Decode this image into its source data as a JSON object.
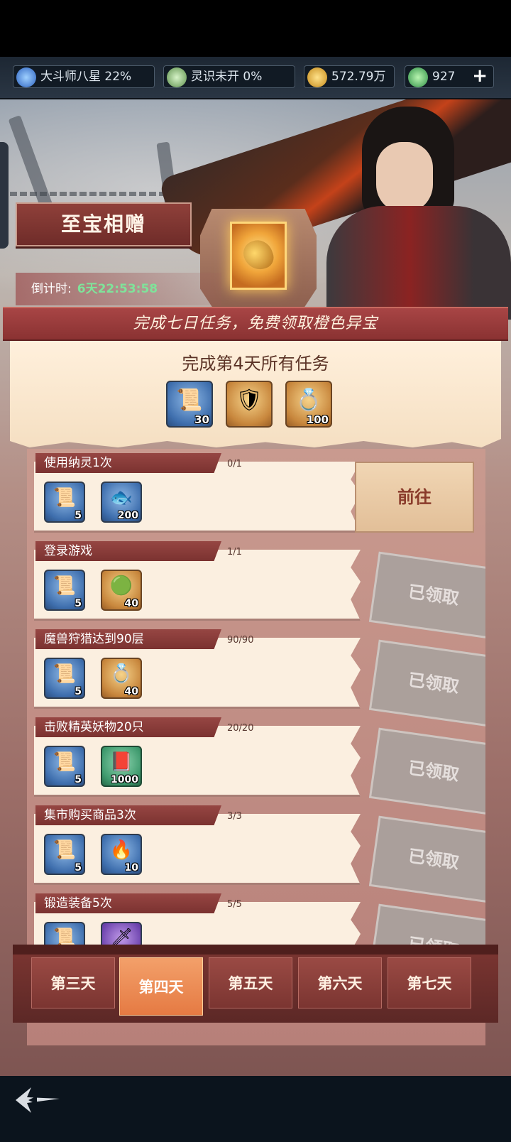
{
  "status": {
    "rank": "大斗师八星 22%",
    "spirit": "灵识未开 0%",
    "gold": "572.79万",
    "gems": "927",
    "plus": "+"
  },
  "event": {
    "title": "至宝相赠",
    "timer_label": "倒计时:",
    "timer_value": "6天22:53:58",
    "ribbon": "完成七日任务，免费领取橙色异宝",
    "reward_title": "完成第4天所有任务",
    "rewards": [
      {
        "icon": "scroll-icon",
        "count": "30"
      },
      {
        "icon": "orange-artifact-icon",
        "count": ""
      },
      {
        "icon": "pink-ring-icon",
        "count": "100"
      }
    ]
  },
  "tasks": [
    {
      "name": "使用纳灵1次",
      "progress": "0/1",
      "items": [
        {
          "icon": "scroll-icon",
          "count": "5"
        },
        {
          "icon": "crystal-fish-icon",
          "count": "200"
        }
      ],
      "action": "前往",
      "claimed": false
    },
    {
      "name": "登录游戏",
      "progress": "1/1",
      "items": [
        {
          "icon": "scroll-icon",
          "count": "5"
        },
        {
          "icon": "jade-ring-icon",
          "count": "40"
        }
      ],
      "action": "已领取",
      "claimed": true
    },
    {
      "name": "魔兽狩猎达到90层",
      "progress": "90/90",
      "items": [
        {
          "icon": "scroll-icon",
          "count": "5"
        },
        {
          "icon": "pink-ring-icon",
          "count": "40"
        }
      ],
      "action": "已领取",
      "claimed": true
    },
    {
      "name": "击败精英妖物20只",
      "progress": "20/20",
      "items": [
        {
          "icon": "scroll-icon",
          "count": "5"
        },
        {
          "icon": "book-icon",
          "count": "1000"
        }
      ],
      "action": "已领取",
      "claimed": true
    },
    {
      "name": "集市购买商品3次",
      "progress": "3/3",
      "items": [
        {
          "icon": "scroll-icon",
          "count": "5"
        },
        {
          "icon": "blue-flame-icon",
          "count": "10"
        }
      ],
      "action": "已领取",
      "claimed": true
    },
    {
      "name": "锻造装备5次",
      "progress": "5/5",
      "items": [
        {
          "icon": "scroll-icon",
          "count": ""
        },
        {
          "icon": "purple-weapon-icon",
          "count": ""
        }
      ],
      "action": "已领取",
      "claimed": true
    }
  ],
  "day_tabs": [
    "第三天",
    "第四天",
    "第五天",
    "第六天",
    "第七天"
  ],
  "active_tab": "第四天"
}
